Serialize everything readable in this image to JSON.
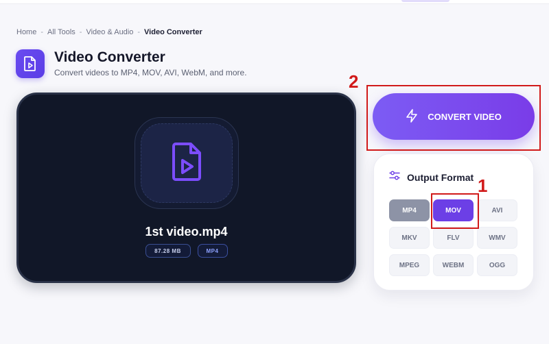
{
  "breadcrumb": {
    "items": [
      "Home",
      "All Tools",
      "Video & Audio"
    ],
    "current": "Video Converter",
    "separator": "-"
  },
  "header": {
    "title": "Video Converter",
    "subtitle": "Convert videos to MP4, MOV, AVI, WebM, and more.",
    "icon": "video-file-icon"
  },
  "preview": {
    "file_name": "1st video.mp4",
    "file_size": "87.28 MB",
    "file_format": "MP4",
    "icon": "video-file-icon"
  },
  "convert": {
    "label": "CONVERT VIDEO",
    "icon": "lightning-icon"
  },
  "output": {
    "title": "Output Format",
    "icon": "sliders-icon",
    "formats": [
      {
        "label": "MP4",
        "state": "source"
      },
      {
        "label": "MOV",
        "state": "selected"
      },
      {
        "label": "AVI",
        "state": "default"
      },
      {
        "label": "MKV",
        "state": "default"
      },
      {
        "label": "FLV",
        "state": "default"
      },
      {
        "label": "WMV",
        "state": "default"
      },
      {
        "label": "MPEG",
        "state": "default"
      },
      {
        "label": "WEBM",
        "state": "default"
      },
      {
        "label": "OGG",
        "state": "default"
      }
    ]
  },
  "annotations": {
    "marker_1": "1",
    "marker_2": "2"
  },
  "colors": {
    "accent": "#6c3fe6",
    "annotation": "#d11a1a",
    "card_dark": "#111728"
  }
}
